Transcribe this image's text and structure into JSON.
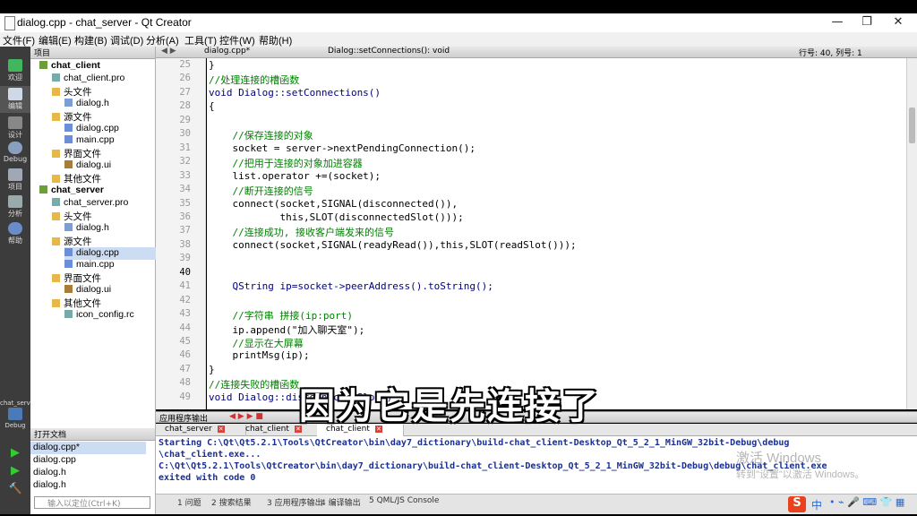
{
  "window": {
    "title": "dialog.cpp - chat_server - Qt Creator"
  },
  "menu": [
    "文件(F)",
    "编辑(E)",
    "构建(B)",
    "调试(D)",
    "分析(A)",
    "工具(T)",
    "控件(W)",
    "帮助(H)"
  ],
  "modes": [
    "欢迎",
    "编辑",
    "设计",
    "Debug",
    "项目",
    "分析",
    "帮助"
  ],
  "kit": {
    "name": "chat_server",
    "label": "Debug"
  },
  "sidebar": {
    "header": "项目",
    "tree": [
      "chat_client",
      "chat_client.pro",
      "头文件",
      "dialog.h",
      "源文件",
      "dialog.cpp",
      "main.cpp",
      "界面文件",
      "dialog.ui",
      "其他文件",
      "chat_server",
      "chat_server.pro",
      "头文件",
      "dialog.h",
      "源文件",
      "dialog.cpp",
      "main.cpp",
      "界面文件",
      "dialog.ui",
      "其他文件",
      "icon_config.rc"
    ]
  },
  "open_files": {
    "header": "打开文档",
    "items": [
      "dialog.cpp*",
      "dialog.cpp",
      "dialog.h",
      "dialog.h"
    ]
  },
  "editor": {
    "file_tab": "dialog.cpp*",
    "function": "Dialog::setConnections(): void",
    "position": "行号: 40, 列号: 1",
    "line_numbers": [
      "25",
      "26",
      "27",
      "28",
      "29",
      "30",
      "31",
      "32",
      "33",
      "34",
      "35",
      "36",
      "37",
      "38",
      "39",
      "40",
      "41",
      "42",
      "43",
      "44",
      "45",
      "46",
      "47",
      "48",
      "49"
    ],
    "lines": [
      "}",
      "//处理连接的槽函数",
      "void Dialog::setConnections()",
      "{",
      "",
      "    //保存连接的对象",
      "    socket = server->nextPendingConnection();",
      "    //把用于连接的对象加进容器",
      "    list.operator +=(socket);",
      "    //断开连接的信号",
      "    connect(socket,SIGNAL(disconnected()),",
      "            this,SLOT(disconnectedSlot()));",
      "    //连接成功, 接收客户端发来的信号",
      "    connect(socket,SIGNAL(readyRead()),this,SLOT(readSlot()));",
      "",
      "",
      "    QString ip=socket->peerAddress().toString();",
      "",
      "    //字符串 拼接(ip:port)",
      "    ip.append(\"加入聊天室\");",
      "    //显示在大屏幕",
      "    printMsg(ip);",
      "}",
      "//连接失败的槽函数",
      "void Dialog::disconnectedSlot()"
    ]
  },
  "output_pane": {
    "header": "应用程序输出",
    "tabs": [
      "chat_server",
      "chat_client",
      "chat_client"
    ],
    "lines": [
      "Starting C:\\Qt\\Qt5.2.1\\Tools\\QtCreator\\bin\\day7_dictionary\\build-chat_client-Desktop_Qt_5_2_1_MinGW_32bit-Debug\\debug",
      "\\chat_client.exe...",
      "C:\\Qt\\Qt5.2.1\\Tools\\QtCreator\\bin\\day7_dictionary\\build-chat_client-Desktop_Qt_5_2_1_MinGW_32bit-Debug\\debug\\chat_client.exe",
      "exited with code 0"
    ]
  },
  "statusbar": {
    "locator_placeholder": "输入以定位(Ctrl+K)",
    "tabs": [
      "1 问题",
      "2 搜索结果",
      "3 应用程序输出",
      "4 编译输出",
      "5 QML/JS Console"
    ]
  },
  "subtitle": "因为它是先连接了",
  "watermark": {
    "line1": "激活 Windows",
    "line2": "转到\"设置\"以激活 Windows。"
  },
  "ime": "中"
}
